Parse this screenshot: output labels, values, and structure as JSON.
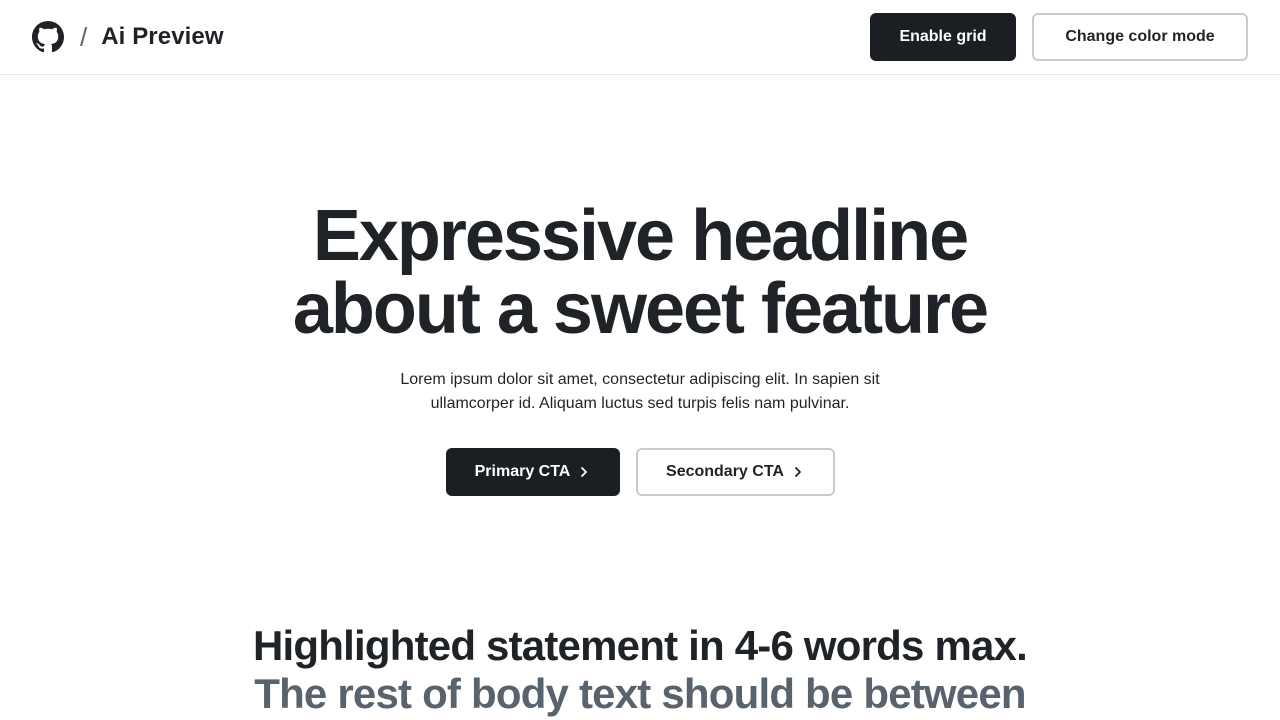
{
  "header": {
    "logo_icon": "github-icon",
    "separator": "/",
    "title": "Ai Preview",
    "enable_grid_label": "Enable grid",
    "change_color_label": "Change color mode"
  },
  "hero": {
    "headline_line1": "Expressive headline",
    "headline_line2": "about a sweet feature",
    "body": "Lorem ipsum dolor sit amet, consectetur adipiscing elit. In sapien sit ullamcorper id. Aliquam luctus sed turpis felis nam pulvinar.",
    "primary_cta": "Primary CTA",
    "secondary_cta": "Secondary CTA"
  },
  "statement": {
    "highlight": "Highlighted statement in 4-6 words max.",
    "rest": "The rest of body text should be between"
  },
  "colors": {
    "text_primary": "#1f2328",
    "text_muted": "#59636e",
    "button_dark": "#1b1f24",
    "button_border": "#c4cbd2",
    "divider": "#e6e8eb"
  }
}
